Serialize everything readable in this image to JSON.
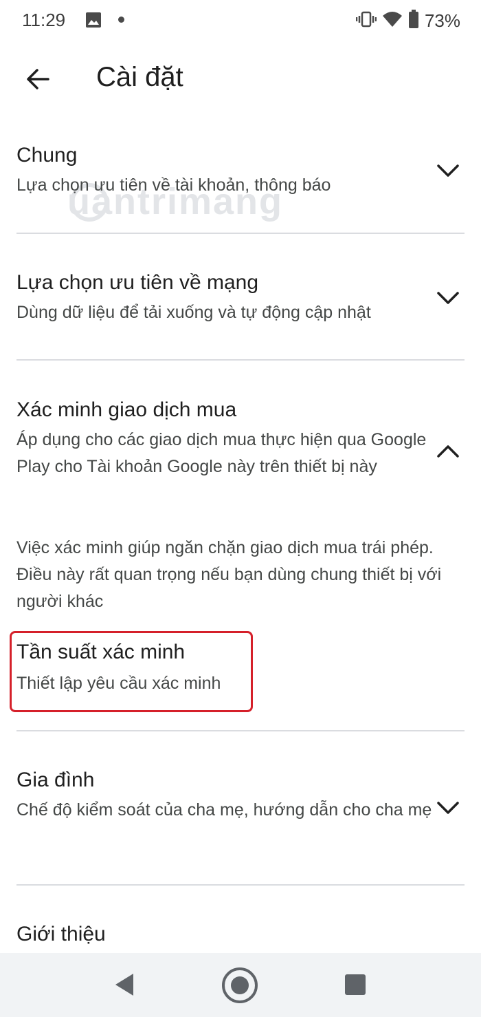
{
  "status_bar": {
    "time": "11:29",
    "battery_percent": "73%",
    "icons": [
      "image-icon",
      "notification-dot-icon",
      "vibrate-icon",
      "wifi-icon",
      "battery-icon"
    ]
  },
  "header": {
    "title": "Cài đặt",
    "back_icon": "arrow-left-icon"
  },
  "watermark": "uantrimang",
  "sections": {
    "general": {
      "title": "Chung",
      "subtitle": "Lựa chọn ưu tiên về tài khoản, thông báo",
      "expanded": false
    },
    "network": {
      "title": "Lựa chọn ưu tiên về mạng",
      "subtitle": "Dùng dữ liệu để tải xuống và tự động cập nhật",
      "expanded": false
    },
    "purchase_verification": {
      "title": "Xác minh giao dịch mua",
      "subtitle": "Áp dụng cho các giao dịch mua thực hiện qua Google Play cho Tài khoản Google này trên thiết bị này",
      "expanded": true,
      "description": "Việc xác minh giúp ngăn chặn giao dịch mua trái phép. Điều này rất quan trọng nếu bạn dùng chung thiết bị với người khác",
      "frequency": {
        "title": "Tần suất xác minh",
        "subtitle": "Thiết lập yêu cầu xác minh"
      }
    },
    "family": {
      "title": "Gia đình",
      "subtitle": "Chế độ kiểm soát của cha mẹ, hướng dẫn cho cha mẹ",
      "expanded": false
    },
    "about": {
      "title": "Giới thiệu"
    }
  },
  "colors": {
    "highlight_border": "#d5202a",
    "divider": "#dadce0",
    "nav_bar_bg": "#f1f3f5"
  },
  "nav_bar": [
    "nav-back-icon",
    "nav-home-icon",
    "nav-recents-icon"
  ]
}
